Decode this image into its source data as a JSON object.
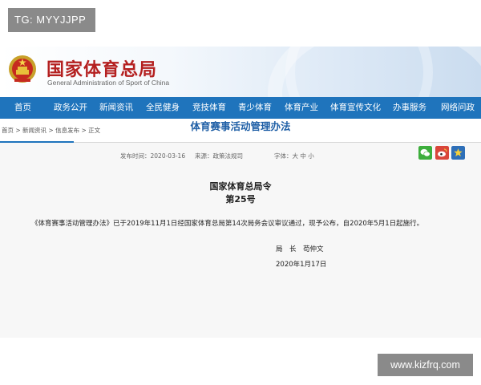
{
  "overlay": {
    "tag": "TG: MYYJJPP",
    "watermark": "www.kizfrq.com"
  },
  "header": {
    "site_name": "国家体育总局",
    "site_name_en": "General Administration of Sport of China"
  },
  "nav": {
    "items": [
      {
        "label": "首页"
      },
      {
        "label": "政务公开"
      },
      {
        "label": "新闻资讯"
      },
      {
        "label": "全民健身"
      },
      {
        "label": "竞技体育"
      },
      {
        "label": "青少体育"
      },
      {
        "label": "体育产业"
      },
      {
        "label": "体育宣传文化"
      },
      {
        "label": "办事服务"
      },
      {
        "label": "网络问政"
      }
    ]
  },
  "breadcrumb": {
    "text": "首页 > 新闻资讯 > 信息发布 > 正文"
  },
  "article": {
    "title": "体育赛事活动管理办法",
    "publish_time": "发布时间：2020-03-16",
    "source": "来源：政策法规司",
    "font_size": "字体：大 中 小",
    "order_title": "国家体育总局令",
    "order_no": "第25号",
    "body": "《体育赛事活动管理办法》已于2019年11月1日经国家体育总局第14次局务会议审议通过，现予公布，自2020年5月1日起施行。",
    "signer": "局　长　苟仲文",
    "date": "2020年1月17日"
  },
  "share": [
    {
      "icon": "wechat-icon",
      "color": "#3dae3c"
    },
    {
      "icon": "weibo-icon",
      "color": "#d9463a"
    },
    {
      "icon": "favorite-star-icon",
      "color": "#2e6fb8"
    }
  ],
  "colors": {
    "brand_red": "#b42020",
    "nav_blue": "#1f74bc",
    "title_blue": "#1f5fa6"
  }
}
